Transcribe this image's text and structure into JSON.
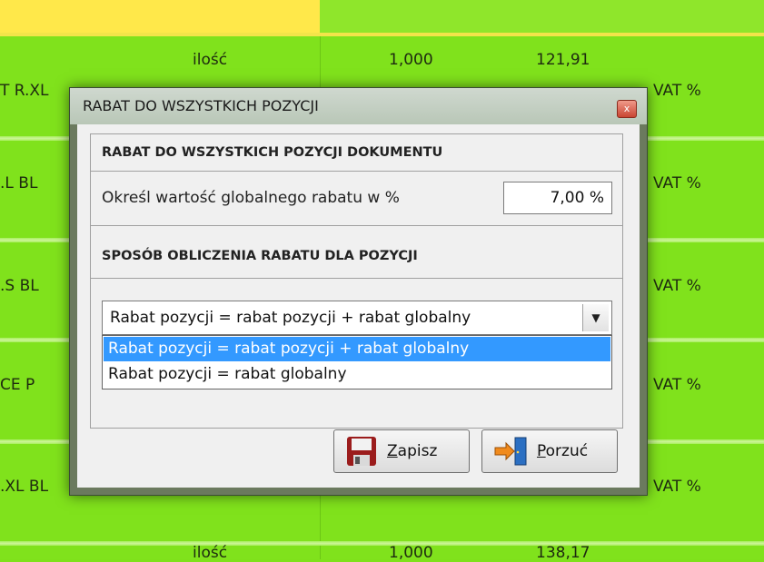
{
  "background": {
    "rows": [
      {
        "left": "T R.XL",
        "qty_label": "ilość",
        "qty": "1,000",
        "price": "121,91",
        "vat": "VAT %"
      },
      {
        "left": ".L BL",
        "vat": "VAT %"
      },
      {
        "left": ".S BL",
        "vat": "VAT %"
      },
      {
        "left": "CE P",
        "vat": "VAT %"
      },
      {
        "left": ".XL BL",
        "vat": "VAT %"
      },
      {
        "qty_label": "ilość",
        "qty": "1,000",
        "price": "138,17"
      }
    ]
  },
  "dialog": {
    "title": "RABAT DO WSZYSTKICH POZYCJI",
    "close_glyph": "x",
    "section1_label": "RABAT DO WSZYSTKICH POZYCJI DOKUMENTU",
    "discount_label": "Określ wartość globalnego rabatu w %",
    "discount_value": "7,00 %",
    "section2_label": "SPOSÓB OBLICZENIA RABATU DLA POZYCJI",
    "method_selected": "Rabat pozycji = rabat pozycji + rabat globalny",
    "method_options": [
      "Rabat pozycji = rabat pozycji + rabat globalny",
      "Rabat pozycji = rabat globalny"
    ],
    "save_label_underlined": "Z",
    "save_label_rest": "apisz",
    "exit_label_underlined": "P",
    "exit_label_rest": "orzuć"
  },
  "icons": {
    "close": "close-icon",
    "dropdown": "chevron-down-icon",
    "save": "floppy-disk-icon",
    "exit": "exit-door-icon"
  },
  "colors": {
    "background_green": "#7fe11a",
    "selection_blue": "#3399ff",
    "close_red": "#c94532"
  }
}
